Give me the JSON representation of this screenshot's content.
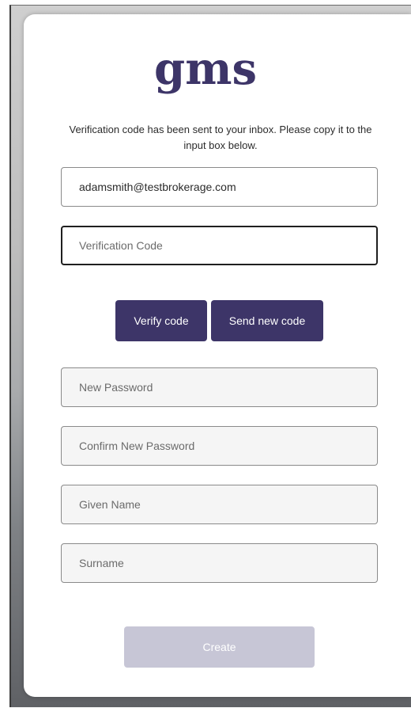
{
  "brand": {
    "logo_text": "gms",
    "logo_color": "#3d3568"
  },
  "message": "Verification code has been sent to your inbox. Please copy it to the input box below.",
  "form": {
    "email_value": "adamsmith@testbrokerage.com",
    "verification_placeholder": "Verification Code",
    "new_password_placeholder": "New Password",
    "confirm_password_placeholder": "Confirm New Password",
    "given_name_placeholder": "Given Name",
    "surname_placeholder": "Surname"
  },
  "buttons": {
    "verify_code": "Verify code",
    "send_new_code": "Send new code",
    "create": "Create"
  },
  "colors": {
    "primary": "#3d3568",
    "disabled_button": "#c7c6d6"
  }
}
